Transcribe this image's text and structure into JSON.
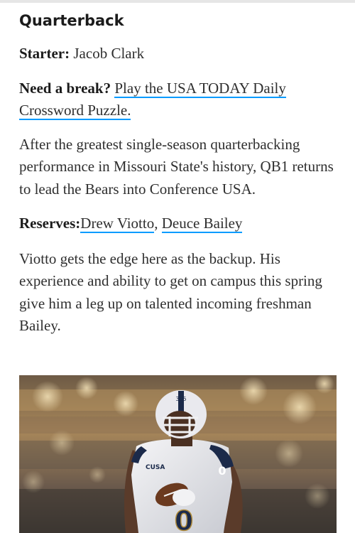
{
  "section": {
    "heading": "Quarterback"
  },
  "starter": {
    "label": "Starter:",
    "name": "Jacob Clark"
  },
  "promo": {
    "label": "Need a break?",
    "link_text": "Play the USA TODAY Daily Crossword Puzzle."
  },
  "summary": "After the greatest single-season quarterbacking performance in Missouri State's history, QB1 returns to lead the Bears into Conference USA.",
  "reserves": {
    "label": "Reserves:",
    "players": [
      "Drew Viotto",
      "Deuce Bailey"
    ],
    "separator": ", "
  },
  "backup_note": "Viotto gets the edge here as the backup. His experience and ability to get on campus this spring give him a leg up on talented incoming freshman Bailey.",
  "photo": {
    "jersey_number": "0",
    "conference_patch": "CUSA",
    "helmet_tag": "385"
  },
  "colors": {
    "link_underline": "#009bff",
    "text": "#2f2f2f"
  }
}
